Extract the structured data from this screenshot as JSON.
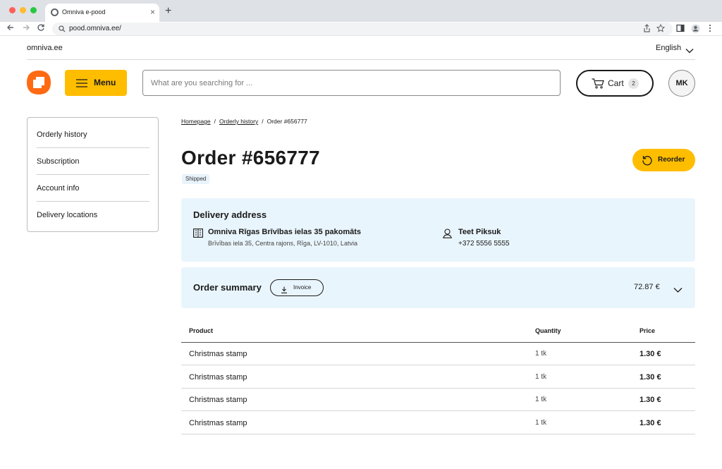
{
  "browser": {
    "tab_title": "Omniva e-pood",
    "url": "pood.omniva.ee/",
    "new_tab_symbol": "+",
    "close_tab_symbol": "×"
  },
  "topbar": {
    "site_link": "omniva.ee",
    "language": "English"
  },
  "header": {
    "menu_label": "Menu",
    "search_placeholder": "What are you searching for ...",
    "cart_label": "Cart",
    "cart_count": "2",
    "user_initials": "MK"
  },
  "sidebar": {
    "items": [
      {
        "label": "Orderly history"
      },
      {
        "label": "Subscription"
      },
      {
        "label": "Account info"
      },
      {
        "label": "Delivery locations"
      }
    ]
  },
  "breadcrumb": {
    "items": [
      "Homepage",
      "Orderly history",
      "Order #656777"
    ],
    "separator": "/"
  },
  "order": {
    "title": "Order #656777",
    "status": "Shipped",
    "reorder_label": "Reorder"
  },
  "delivery": {
    "title": "Delivery address",
    "location_name": "Omniva Rīgas Brīvības ielas 35 pakomāts",
    "location_address": "Brīvības iela 35, Centra rajons, Rīga, LV-1010, Latvia",
    "recipient_name": "Teet Piksuk",
    "recipient_phone": "+372 5556 5555"
  },
  "summary": {
    "title": "Order summary",
    "invoice_label": "Invoice",
    "total": "72.87 €"
  },
  "table": {
    "headers": {
      "product": "Product",
      "quantity": "Quantity",
      "price": "Price"
    },
    "rows": [
      {
        "product": "Christmas stamp",
        "quantity": "1 tk",
        "price": "1.30 €"
      },
      {
        "product": "Christmas stamp",
        "quantity": "1 tk",
        "price": "1.30 €"
      },
      {
        "product": "Christmas stamp",
        "quantity": "1 tk",
        "price": "1.30 €"
      },
      {
        "product": "Christmas stamp",
        "quantity": "1 tk",
        "price": "1.30 €"
      }
    ]
  },
  "colors": {
    "brand_orange": "#ff6a13",
    "accent_yellow": "#ffbd00",
    "panel_blue": "#e9f5fc"
  },
  "icons": [
    "chrome-icon",
    "back-arrow-icon",
    "forward-arrow-icon",
    "reload-icon",
    "site-info-icon",
    "share-icon",
    "bookmark-star-icon",
    "sidebar-toggle-icon",
    "profile-icon",
    "kebab-menu-icon",
    "chevron-down-icon",
    "omniva-logo",
    "hamburger-icon",
    "cart-icon",
    "reorder-icon",
    "building-icon",
    "person-icon",
    "download-icon"
  ]
}
